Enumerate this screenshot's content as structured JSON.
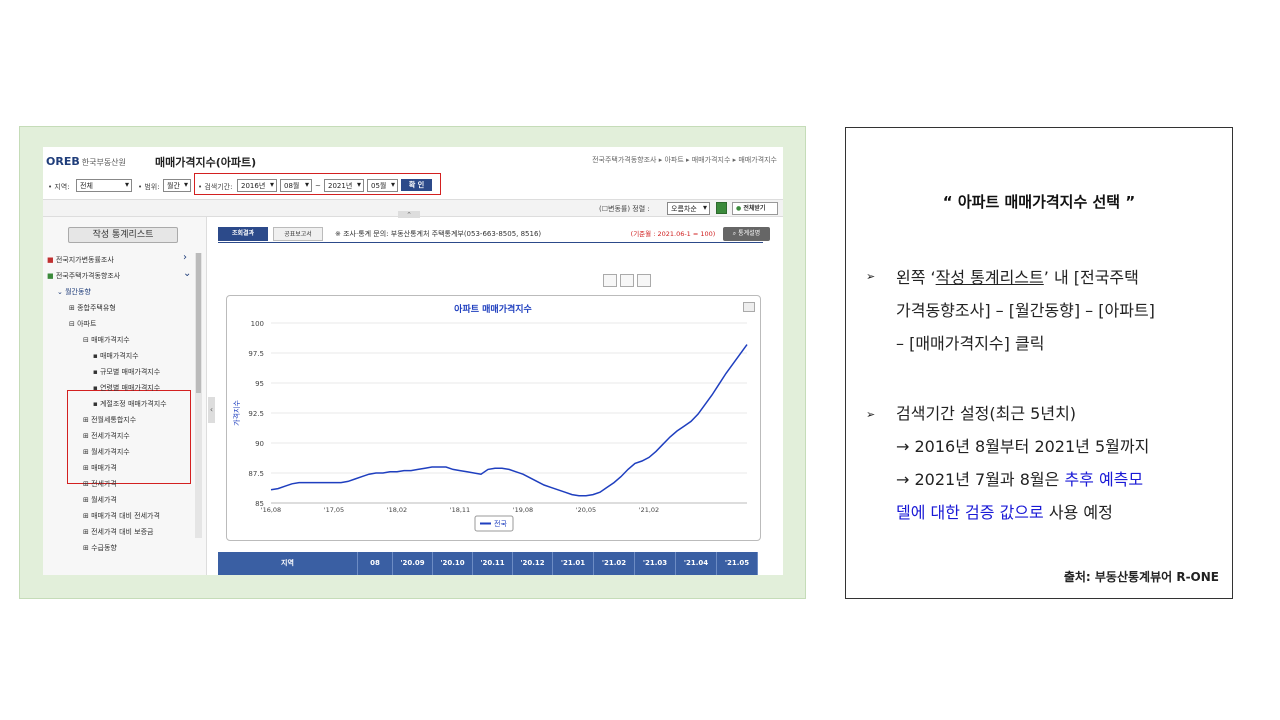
{
  "screenshot": {
    "logo": "OREB",
    "logo_org": "한국부동산원",
    "page_title": "매매가격지수(아파트)",
    "breadcrumb": "전국주택가격동향조사 ▸ 아파트 ▸ 매매가격지수 ▸ 매매가격지수",
    "filters": {
      "region_label": "• 지역:",
      "region_value": "전체",
      "range_label": "• 범위:",
      "range_value": "월간",
      "period_label": "• 검색기간:",
      "start_year": "2016년",
      "start_month": "08월",
      "tilde": "~",
      "end_year": "2021년",
      "end_month": "05월",
      "confirm": "확 인"
    },
    "toolbar": {
      "change_rate": "(☐변동률) 정렬 :",
      "sort_value": "오름차순",
      "download": "전체받기",
      "collapse_arrow": "⌃",
      "side_arrow": "‹"
    },
    "sidebar": {
      "list_button": "작성 통계리스트",
      "items": [
        {
          "label": "■ 전국지가변동률조사",
          "arrow": "›"
        },
        {
          "label": "■ 전국주택가격동향조사",
          "arrow": "⌄"
        },
        {
          "label": "⌄ 월간동향"
        },
        {
          "label": "⊞ 종합주택유형"
        },
        {
          "label": "⊟ 아파트"
        },
        {
          "label": "⊟ 매매가격지수"
        },
        {
          "label": "▪ 매매가격지수"
        },
        {
          "label": "▪ 규모별 매매가격지수"
        },
        {
          "label": "▪ 연령별 매매가격지수"
        },
        {
          "label": "▪ 계절조정 매매가격지수"
        },
        {
          "label": "⊞ 전월세통합지수"
        },
        {
          "label": "⊞ 전세가격지수"
        },
        {
          "label": "⊞ 월세가격지수"
        },
        {
          "label": "⊞ 매매가격"
        },
        {
          "label": "⊞ 전세가격"
        },
        {
          "label": "⊞ 월세가격"
        },
        {
          "label": "⊞ 매매가격 대비 전세가격"
        },
        {
          "label": "⊞ 전세가격 대비 보증금"
        },
        {
          "label": "⊞ 수급동향"
        }
      ]
    },
    "tabs": {
      "result": "조회결과",
      "report": "공표보고서",
      "contact": "※ 조사·통계 문의: 부동산통계처 주택통계부(053-663-8505, 8516)",
      "base": "(기준월 : 2021.06-1 = 100)",
      "description": "통계설명"
    },
    "table_header": [
      "지역",
      "08",
      "'20.09",
      "'20.10",
      "'20.11",
      "'20.12",
      "'21.01",
      "'21.02",
      "'21.03",
      "'21.04",
      "'21.05"
    ]
  },
  "chart_data": {
    "type": "line",
    "title": "아파트 매매가격지수",
    "xlabel": "",
    "ylabel": "가격지수",
    "ylim": [
      85,
      100
    ],
    "yticks": [
      85,
      87.5,
      90,
      92.5,
      95,
      97.5,
      100
    ],
    "xtick_labels": [
      "'16,08",
      "'17,05",
      "'18,02",
      "'18,11",
      "'19,08",
      "'20,05",
      "'21,02"
    ],
    "legend": "bottom-center",
    "series": [
      {
        "name": "전국",
        "color": "#1f3fbf",
        "values": [
          86.1,
          86.2,
          86.4,
          86.6,
          86.7,
          86.7,
          86.7,
          86.7,
          86.7,
          86.7,
          86.7,
          86.8,
          87.0,
          87.2,
          87.4,
          87.5,
          87.5,
          87.6,
          87.6,
          87.7,
          87.7,
          87.8,
          87.9,
          88.0,
          88.0,
          88.0,
          87.8,
          87.7,
          87.6,
          87.5,
          87.4,
          87.8,
          87.9,
          87.9,
          87.8,
          87.6,
          87.4,
          87.1,
          86.8,
          86.5,
          86.3,
          86.1,
          85.9,
          85.7,
          85.6,
          85.6,
          85.7,
          85.9,
          86.3,
          86.7,
          87.2,
          87.8,
          88.3,
          88.5,
          88.8,
          89.3,
          89.9,
          90.5,
          91.0,
          91.4,
          91.8,
          92.4,
          93.2,
          94.0,
          94.9,
          95.8,
          96.6,
          97.4,
          98.2
        ]
      }
    ]
  },
  "right_panel": {
    "title": "“ 아파트 매매가격지수 선택 ”",
    "bullet_symbol": "➢",
    "b1_pre": "왼쪽 ‘",
    "b1_link": "작성 통계리스트",
    "b1_post": "’ 내 [전국주택",
    "b1_line2": "가격동향조사] – [월간동향] – [아파트]",
    "b1_line3": "– [매매가격지수] 클릭",
    "b2_line1": "검색기간 설정(최근 5년치)",
    "b2_line2": "→ 2016년 8월부터 2021년 5월까지",
    "b2_line3_pre": "→ 2021년 7월과 8월은 ",
    "b2_line3_blue": "추후 예측모",
    "b2_line4_blue": "델에 대한 검증 값으로",
    "b2_line4_post": " 사용 예정",
    "source": "출처: 부동산통계뷰어 R-ONE"
  }
}
